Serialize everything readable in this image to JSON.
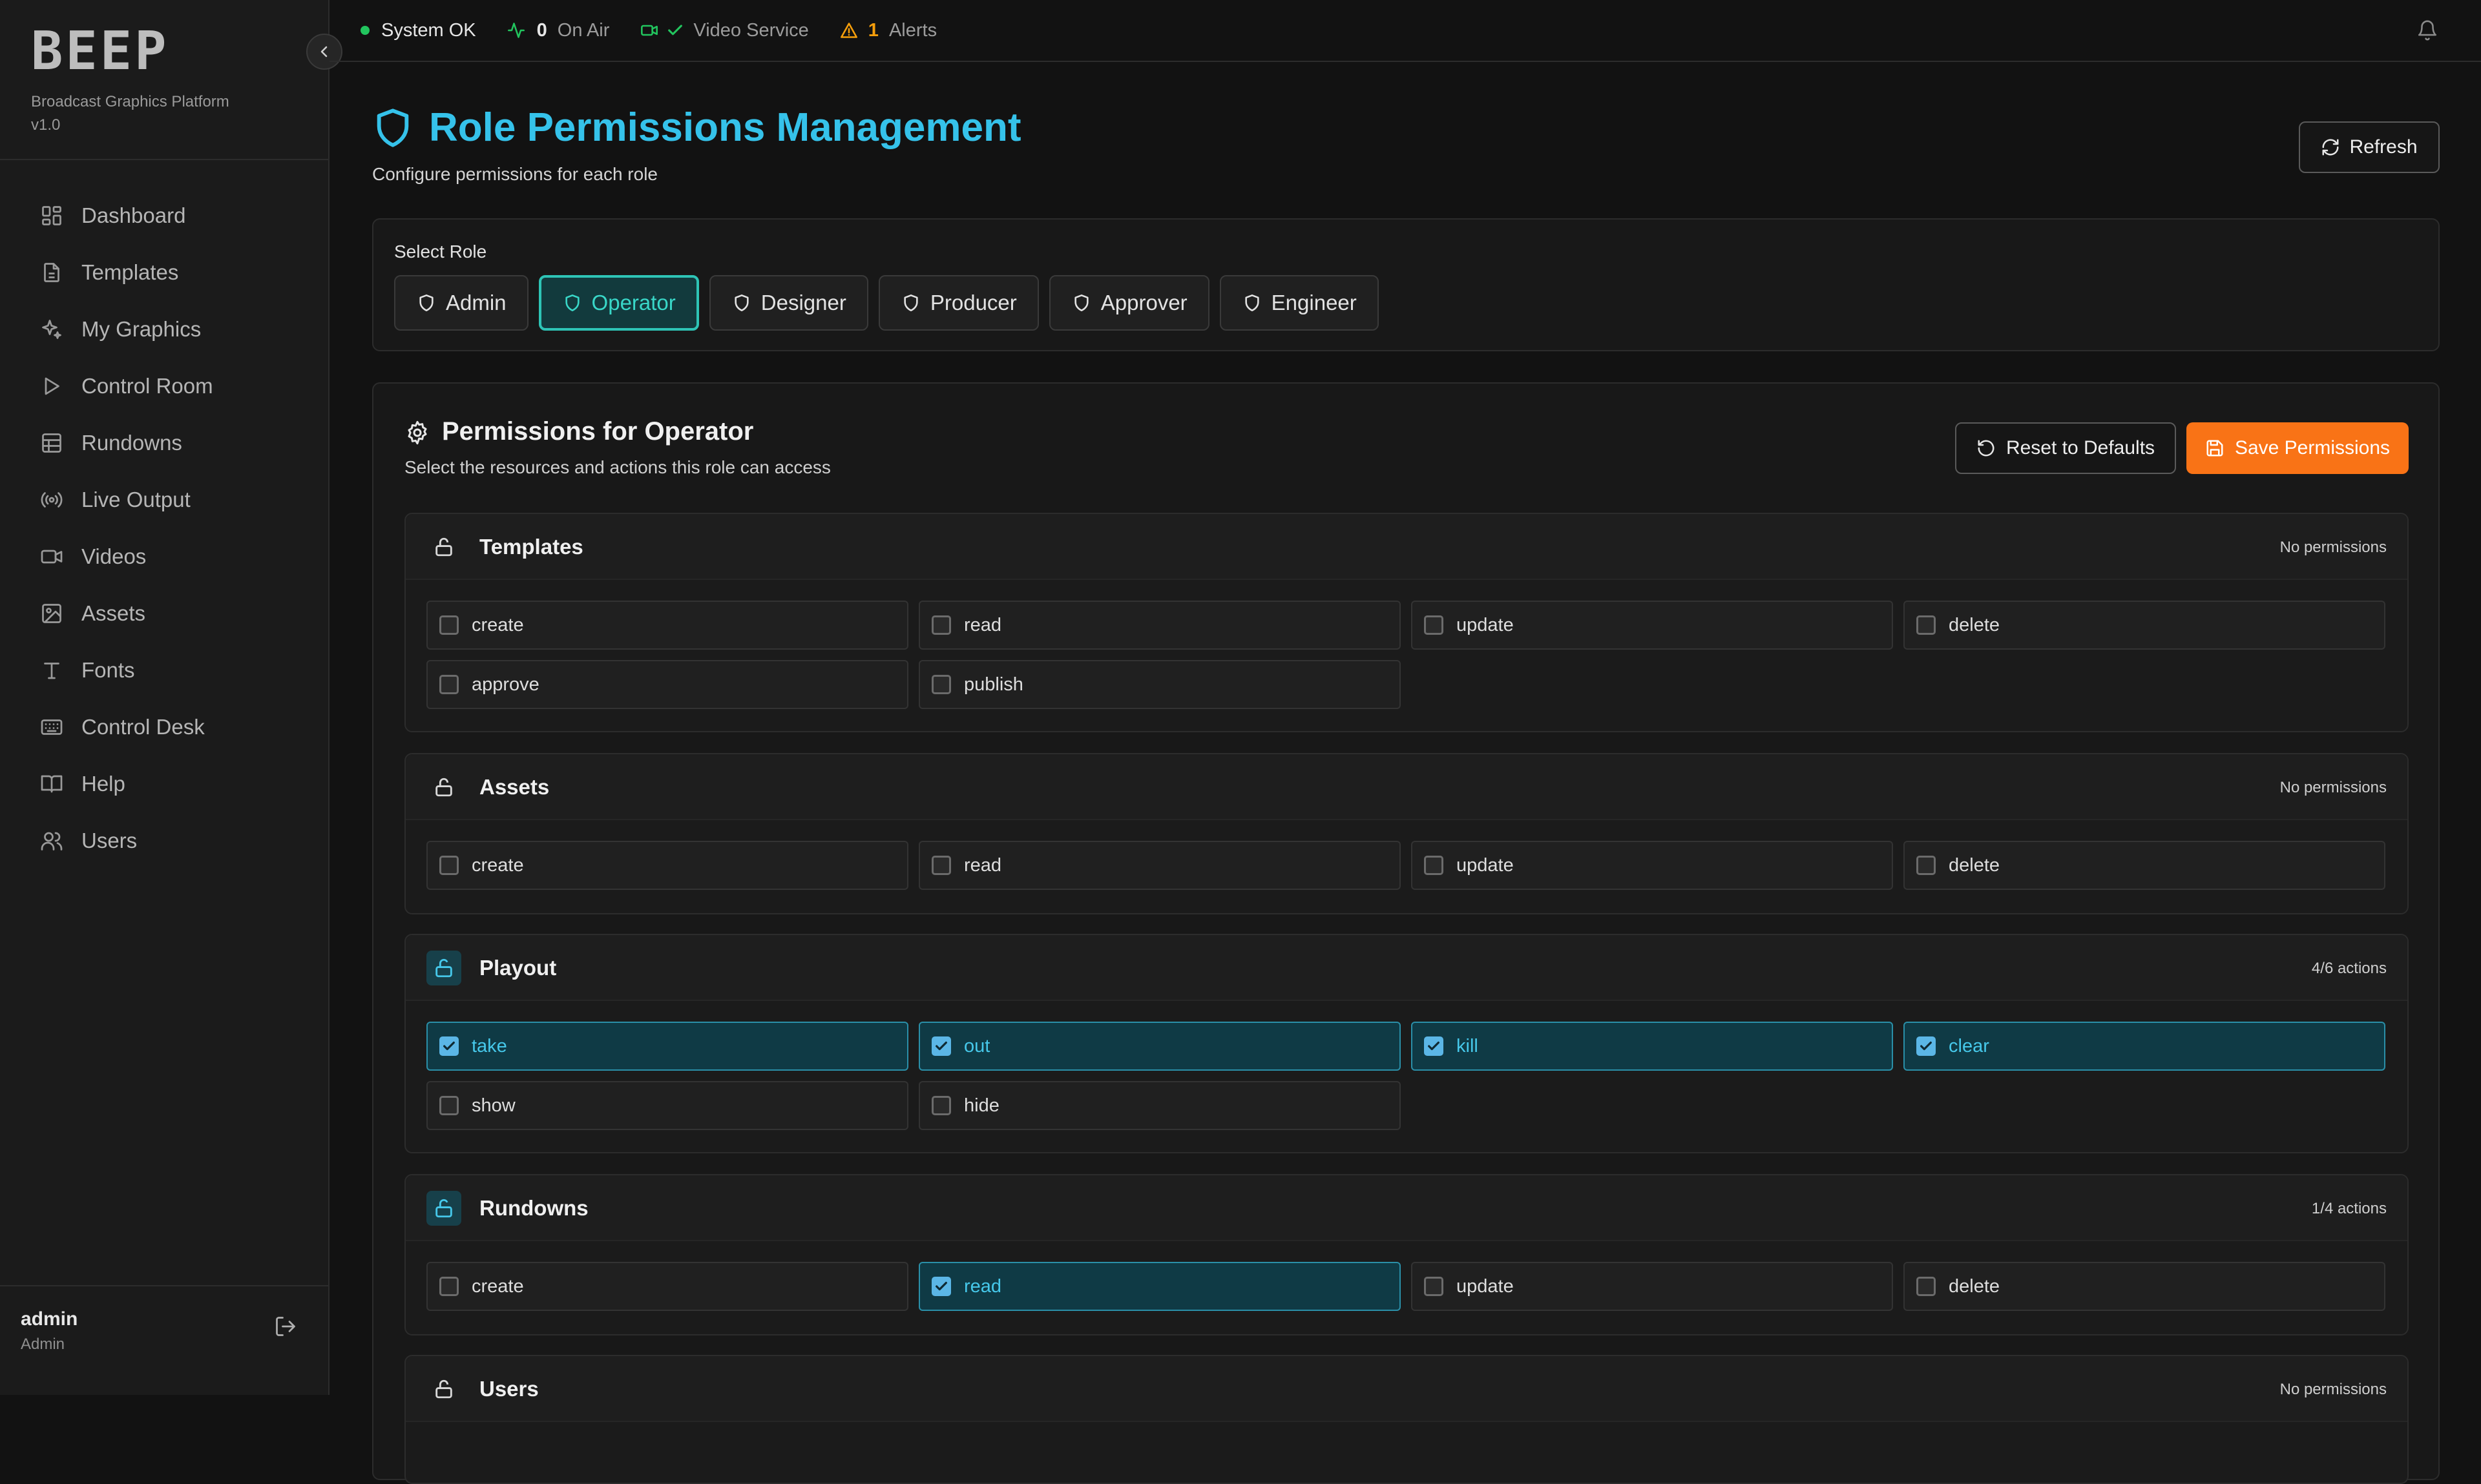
{
  "brand": {
    "logo": "BEEP",
    "subtitle": "Broadcast Graphics Platform",
    "version": "v1.0"
  },
  "sidebar": {
    "items": [
      {
        "label": "Dashboard",
        "icon": "dashboard-icon"
      },
      {
        "label": "Templates",
        "icon": "file-text-icon"
      },
      {
        "label": "My Graphics",
        "icon": "sparkles-icon"
      },
      {
        "label": "Control Room",
        "icon": "play-icon"
      },
      {
        "label": "Rundowns",
        "icon": "table-icon"
      },
      {
        "label": "Live Output",
        "icon": "broadcast-icon"
      },
      {
        "label": "Videos",
        "icon": "video-icon"
      },
      {
        "label": "Assets",
        "icon": "image-icon"
      },
      {
        "label": "Fonts",
        "icon": "type-icon"
      },
      {
        "label": "Control Desk",
        "icon": "keyboard-icon"
      },
      {
        "label": "Help",
        "icon": "book-icon"
      },
      {
        "label": "Users",
        "icon": "users-icon"
      }
    ],
    "user": {
      "name": "admin",
      "role": "Admin"
    }
  },
  "topbar": {
    "system": "System OK",
    "on_air_count": "0",
    "on_air_label": "On Air",
    "video_service": "Video Service",
    "alerts_count": "1",
    "alerts_label": "Alerts"
  },
  "page": {
    "title": "Role Permissions Management",
    "subtitle": "Configure permissions for each role",
    "refresh_label": "Refresh"
  },
  "roles": {
    "label": "Select Role",
    "items": [
      "Admin",
      "Operator",
      "Designer",
      "Producer",
      "Approver",
      "Engineer"
    ],
    "selected": "Operator"
  },
  "permissions": {
    "title": "Permissions for Operator",
    "subtitle": "Select the resources and actions this role can access",
    "reset_label": "Reset to Defaults",
    "save_label": "Save Permissions",
    "sections": [
      {
        "name": "Templates",
        "count": "No permissions",
        "actions": [
          {
            "label": "create",
            "checked": false
          },
          {
            "label": "read",
            "checked": false
          },
          {
            "label": "update",
            "checked": false
          },
          {
            "label": "delete",
            "checked": false
          },
          {
            "label": "approve",
            "checked": false
          },
          {
            "label": "publish",
            "checked": false
          }
        ]
      },
      {
        "name": "Assets",
        "count": "No permissions",
        "actions": [
          {
            "label": "create",
            "checked": false
          },
          {
            "label": "read",
            "checked": false
          },
          {
            "label": "update",
            "checked": false
          },
          {
            "label": "delete",
            "checked": false
          }
        ]
      },
      {
        "name": "Playout",
        "count": "4/6 actions",
        "actions": [
          {
            "label": "take",
            "checked": true
          },
          {
            "label": "out",
            "checked": true
          },
          {
            "label": "kill",
            "checked": true
          },
          {
            "label": "clear",
            "checked": true
          },
          {
            "label": "show",
            "checked": false
          },
          {
            "label": "hide",
            "checked": false
          }
        ]
      },
      {
        "name": "Rundowns",
        "count": "1/4 actions",
        "actions": [
          {
            "label": "create",
            "checked": false
          },
          {
            "label": "read",
            "checked": true
          },
          {
            "label": "update",
            "checked": false
          },
          {
            "label": "delete",
            "checked": false
          }
        ]
      },
      {
        "name": "Users",
        "count": "No permissions",
        "actions": []
      }
    ]
  },
  "colors": {
    "accent": "#35c2ea",
    "selected_role": "#2ec4b6",
    "save": "#f97316",
    "status_ok": "#22c55e",
    "alert": "#f59e0b"
  }
}
